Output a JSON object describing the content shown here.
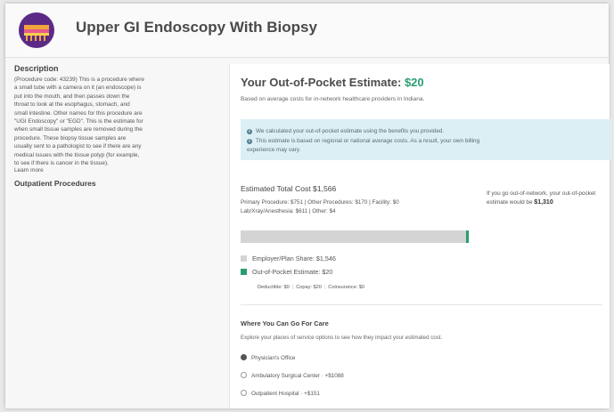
{
  "header": {
    "title": "Upper GI Endoscopy With Biopsy",
    "logo_icon": "endoscopy-icon"
  },
  "sidebar": {
    "description_heading": "Description",
    "description_lines": [
      "(Procedure code: 43239) This is a procedure where",
      "a small tube with a camera on it (an endoscope) is",
      "put into the mouth, and then passes down the",
      "throat to look at the esophagus, stomach, and",
      "small intestine. Other names for this procedure are",
      "\"UGI Endoscopy\" or \"EGD\". This is the estimate for",
      "when small tissue samples are removed during the",
      "procedure. These biopsy tissue samples are",
      "usually sent to a pathologist to see if there are any",
      "medical issues with the tissue polyp (for example,",
      "to see if there is cancer in the tissue)."
    ],
    "learn_more": "Learn more",
    "category_heading": "Outpatient Procedures"
  },
  "estimate": {
    "title_prefix": "Your Out-of-Pocket Estimate: ",
    "title_amount": "$20",
    "subtitle": "Based on average costs for in-network healthcare providers in Indiana.",
    "info_1": "We calculated your out-of-pocket estimate using the benefits you provided.",
    "info_2a": "This estimate is based on regional or national average costs. As a result, your own billing",
    "info_2b": "experience may vary.",
    "total": "Estimated Total Cost $1,566",
    "breakdown_1": "Primary Procedure: $751  |  Other Procedures: $170  |  Facility: $0",
    "breakdown_2": "Lab/Xray/Anesthesia: $611  |  Other: $4",
    "oon_text": "If you go out-of-network, your out-of-pocket estimate would be",
    "oon_amount": "$1,310",
    "bar_oop_fraction": 0.013,
    "legend_employer": "Employer/Plan Share: $1,546",
    "legend_oop": "Out-of-Pocket Estimate: $20",
    "deductible": "Deductible: $0",
    "copay": "Copay: $20",
    "coinsurance": "Coinsurance: $0",
    "colors": {
      "accent": "#2a9d6f",
      "employer": "#d4d4d4",
      "info_bg": "#dceff5"
    }
  },
  "where": {
    "title": "Where You Can Go For Care",
    "subtitle": "Explore your places of service options to see how they impact your estimated cost.",
    "options": [
      {
        "label": "Physician's Office",
        "selected": true
      },
      {
        "label": "Ambulatory Surgical Center · +$1088",
        "selected": false
      },
      {
        "label": "Outpatient Hospital · +$151",
        "selected": false
      }
    ]
  }
}
